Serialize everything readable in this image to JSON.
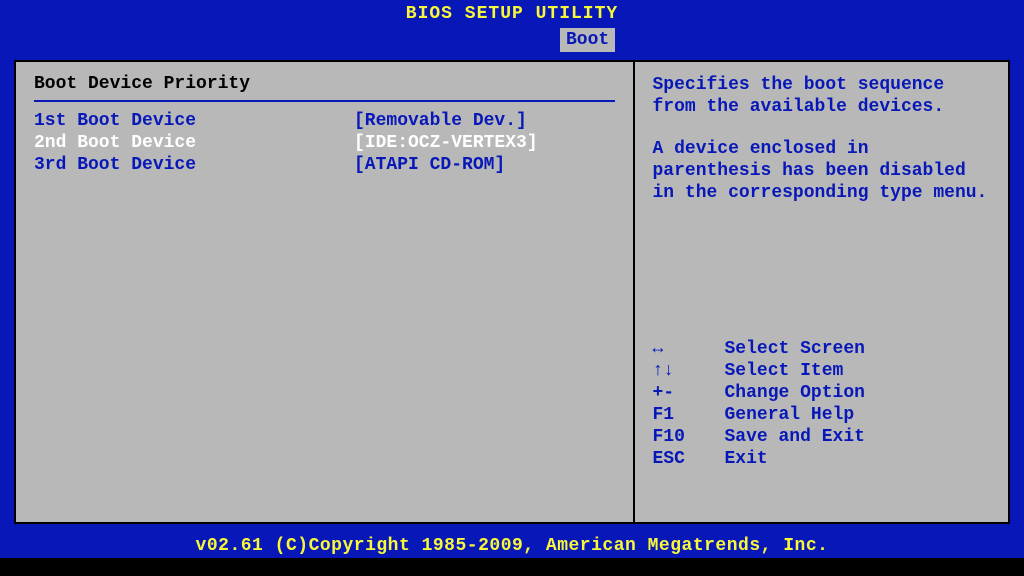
{
  "title": "BIOS SETUP UTILITY",
  "active_tab": "Boot",
  "section_title": "Boot Device Priority",
  "boot_items": [
    {
      "label": "1st Boot Device",
      "value": "[Removable Dev.]",
      "selected": false
    },
    {
      "label": "2nd Boot Device",
      "value": "[IDE:OCZ-VERTEX3]",
      "selected": true
    },
    {
      "label": "3rd Boot Device",
      "value": "[ATAPI CD-ROM]",
      "selected": false
    }
  ],
  "help": {
    "para1": "Specifies the boot sequence from the available devices.",
    "para2": "A device enclosed in parenthesis has been disabled in the corresponding type menu."
  },
  "keys": [
    {
      "sym": "↔",
      "desc": "Select Screen"
    },
    {
      "sym": "↑↓",
      "desc": "Select Item"
    },
    {
      "sym": "+-",
      "desc": "Change Option"
    },
    {
      "sym": "F1",
      "desc": "General Help"
    },
    {
      "sym": "F10",
      "desc": "Save and Exit"
    },
    {
      "sym": "ESC",
      "desc": "Exit"
    }
  ],
  "footer": "v02.61 (C)Copyright 1985-2009, American Megatrends, Inc."
}
